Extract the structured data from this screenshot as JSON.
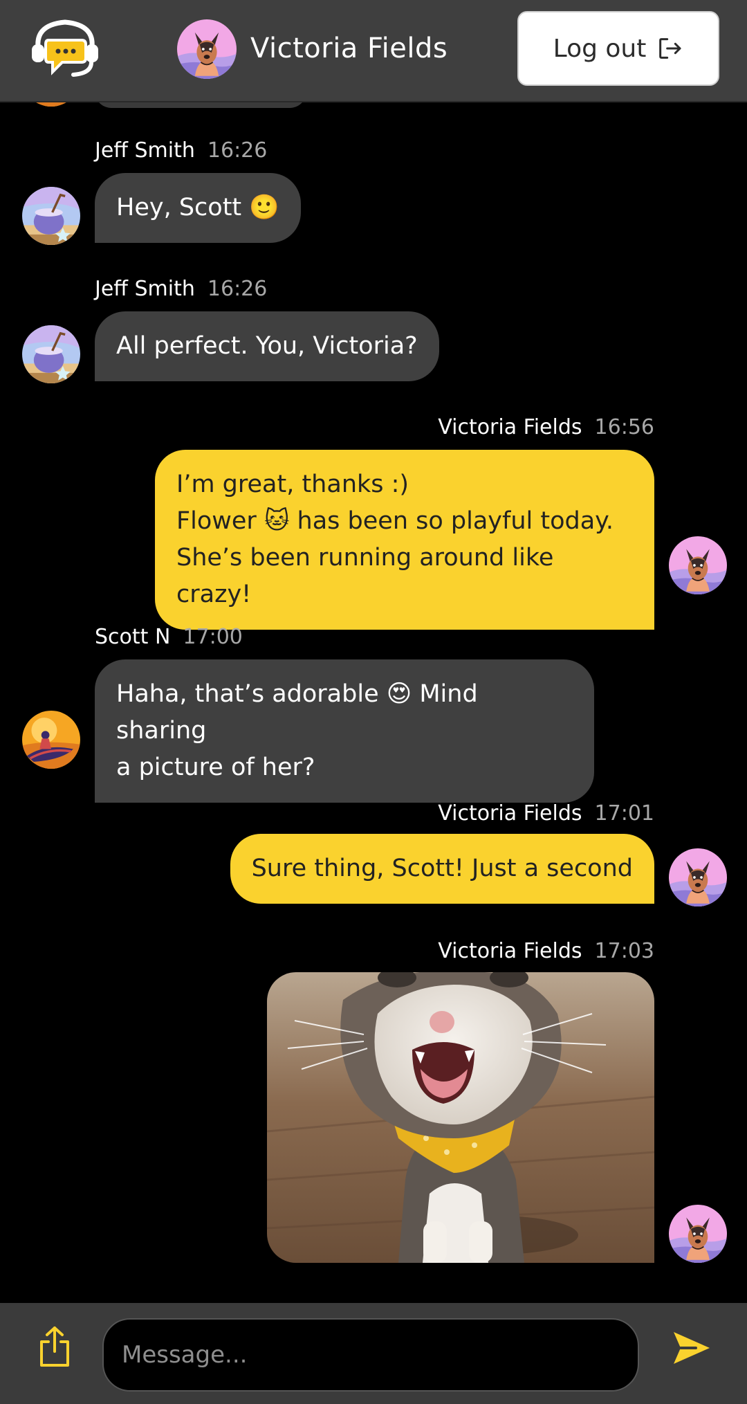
{
  "header": {
    "current_user_name": "Victoria Fields",
    "logout_label": "Log out"
  },
  "messages": [
    {
      "sender": "Jeff Smith",
      "time": "16:26",
      "text": "Hey, Scott 🙂",
      "direction": "incoming",
      "avatar": "coconut-drink-avatar"
    },
    {
      "sender": "Jeff Smith",
      "time": "16:26",
      "text": "All perfect. You, Victoria?",
      "direction": "incoming",
      "avatar": "coconut-drink-avatar"
    },
    {
      "sender": "Victoria Fields",
      "time": "16:56",
      "text": "I’m great, thanks :)\nFlower 🐱 has been so playful today.\nShe’s been running around like crazy!",
      "direction": "outgoing",
      "avatar": "dog-avatar"
    },
    {
      "sender": "Scott N",
      "time": "17:00",
      "text": "Haha, that’s adorable 😍 Mind sharing\na picture of her?",
      "direction": "incoming",
      "avatar": "jet-ski-avatar"
    },
    {
      "sender": "Victoria Fields",
      "time": "17:01",
      "text": "Sure thing, Scott! Just a second",
      "direction": "outgoing",
      "avatar": "dog-avatar"
    },
    {
      "sender": "Victoria Fields",
      "time": "17:03",
      "image": "cat-photo",
      "direction": "outgoing",
      "avatar": "dog-avatar"
    }
  ],
  "composer": {
    "placeholder": "Message...",
    "upload_icon": "share-upload-icon",
    "send_icon": "send-arrow-icon"
  },
  "colors": {
    "accent": "#fad22e",
    "header_bg": "#3f3f3f",
    "incoming_bubble": "#404040",
    "background": "#000000"
  }
}
